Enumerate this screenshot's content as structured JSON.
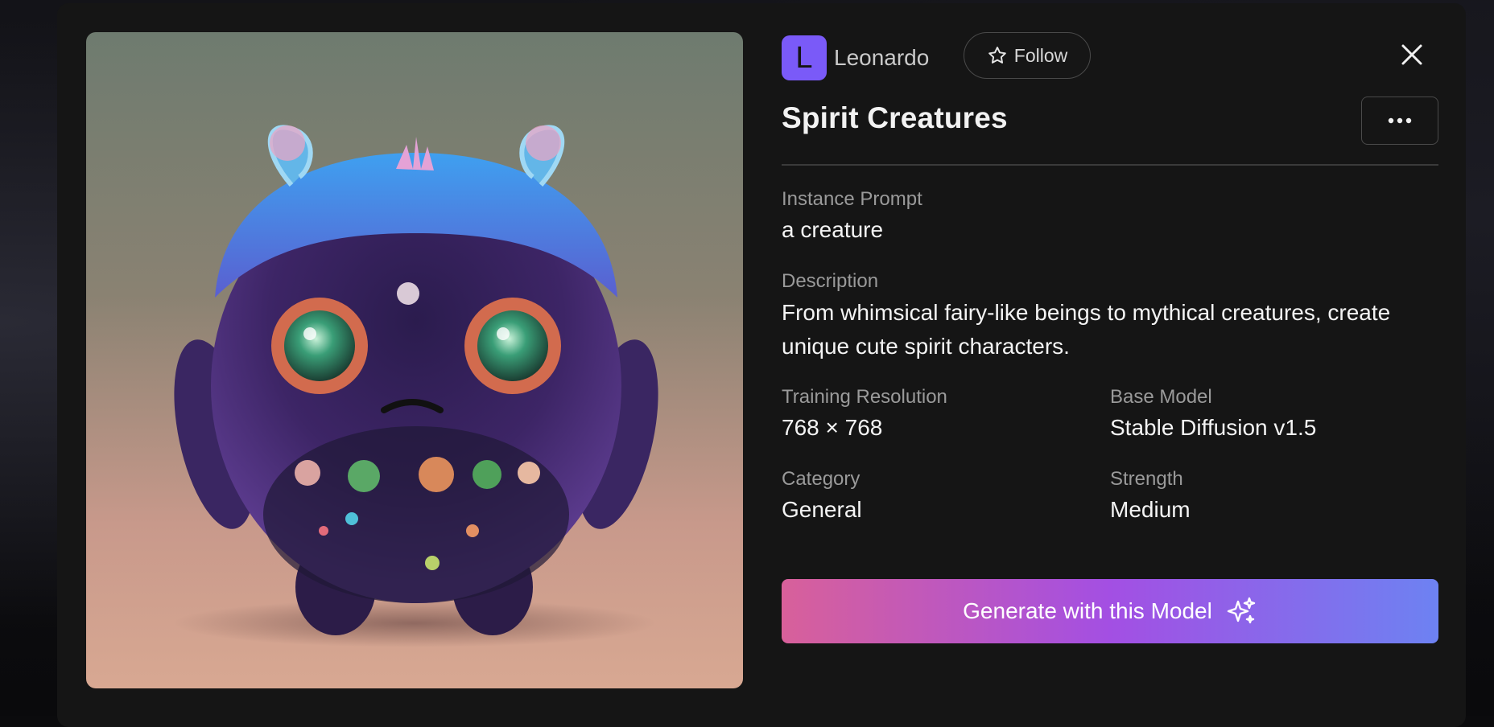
{
  "modal": {
    "owner": {
      "avatar_letter": "L",
      "name": "Leonardo",
      "avatar_color": "#7a5af8"
    },
    "follow_label": "Follow",
    "title": "Spirit Creatures",
    "fields": {
      "instance_prompt": {
        "label": "Instance Prompt",
        "value": "a creature"
      },
      "description": {
        "label": "Description",
        "value": "From whimsical fairy-like beings to mythical creatures, create unique cute spirit characters."
      },
      "training_resolution": {
        "label": "Training Resolution",
        "value": "768 × 768"
      },
      "base_model": {
        "label": "Base Model",
        "value": "Stable Diffusion v1.5"
      },
      "category": {
        "label": "Category",
        "value": "General"
      },
      "strength": {
        "label": "Strength",
        "value": "Medium"
      }
    },
    "generate_label": "Generate with this Model",
    "icons": [
      "star-icon",
      "close-icon",
      "more-icon",
      "sparkle-icon"
    ],
    "colors": {
      "accent_gradient": [
        "#d8609a",
        "#a34fe3",
        "#6d82f2"
      ],
      "panel": "#151515"
    }
  }
}
